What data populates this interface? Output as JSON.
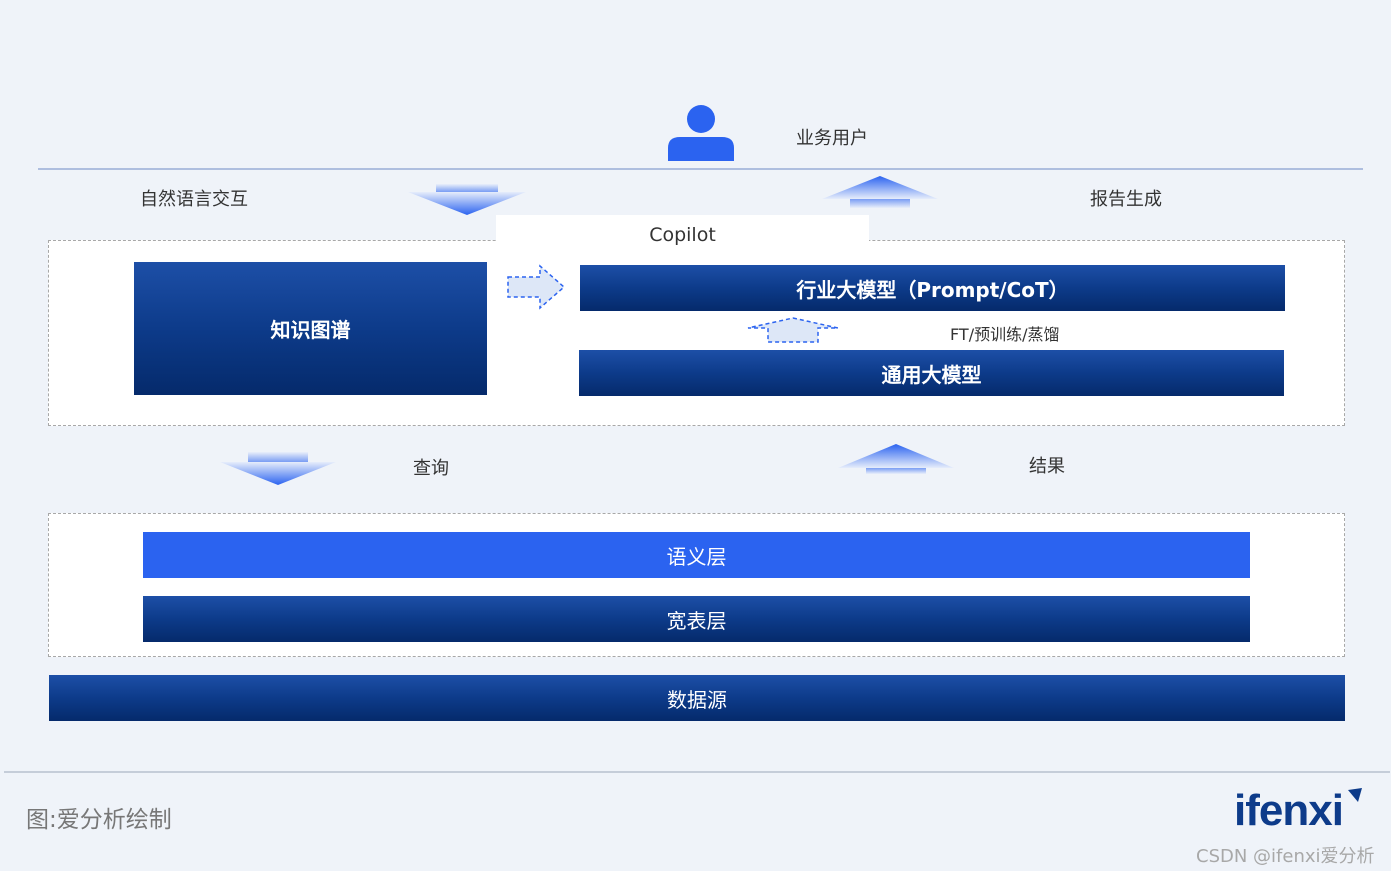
{
  "user": {
    "icon": "user-icon",
    "label": "业务用户"
  },
  "flow": {
    "left_label": "自然语言交互",
    "right_label": "报告生成",
    "query_label": "查询",
    "result_label": "结果"
  },
  "copilot": {
    "tab_label": "Copilot",
    "knowledge_graph": "知识图谱",
    "industry_model": "行业大模型（Prompt/CoT）",
    "finetune_label": "FT/预训练/蒸馏",
    "general_model": "通用大模型"
  },
  "data_layers": {
    "semantic": "语义层",
    "wide_table": "宽表层"
  },
  "data_source": "数据源",
  "footer": {
    "caption": "图:爱分析绘制",
    "logo": "ifenxi",
    "watermark": "CSDN @ifenxi爱分析"
  },
  "colors": {
    "background": "#eff3f9",
    "navy": "#0d3b8a",
    "bright_blue": "#2b63f0",
    "divider": "#aebedf"
  }
}
